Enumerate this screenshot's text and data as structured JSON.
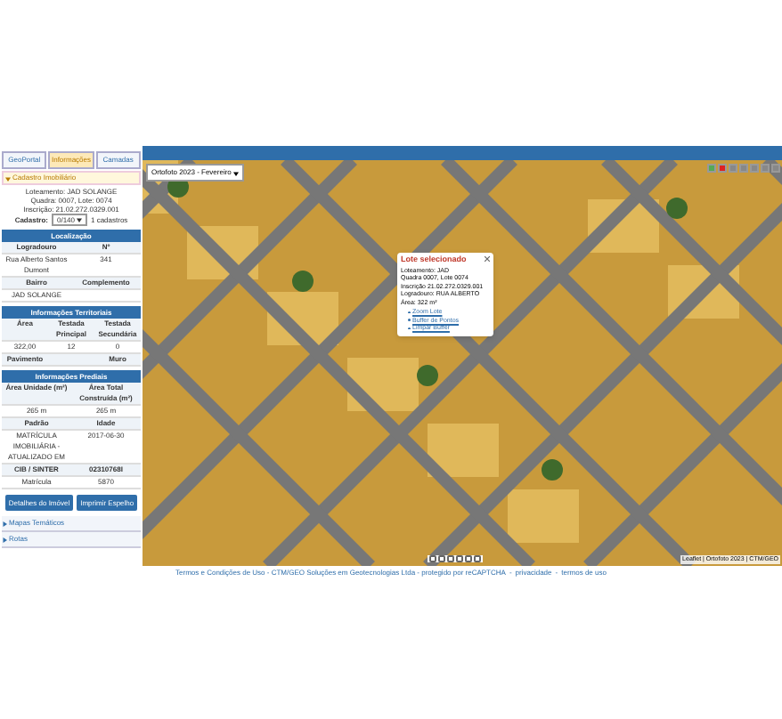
{
  "tabs": [
    {
      "label": "GeoPortal",
      "selected": false
    },
    {
      "label": "Informações",
      "selected": true
    },
    {
      "label": "Camadas",
      "selected": false
    }
  ],
  "section": {
    "title": "Cadastro Imobiliário",
    "expanded": true
  },
  "summary": [
    "Loteamento: JAD SOLANGE",
    "Quadra: 0007, Lote: 0074",
    "Inscrição: 21.02.272.0329.001"
  ],
  "cadastro": {
    "label": "Cadastro:",
    "value": "0/140",
    "count": "1 cadastros"
  },
  "tables": [
    {
      "title": "Localização",
      "rows": [
        [
          "Logradouro",
          "Nº"
        ],
        [
          "Rua Alberto Santos Dumont",
          "341"
        ],
        [
          "Bairro",
          "Complemento"
        ],
        [
          "JAD SOLANGE",
          ""
        ]
      ]
    },
    {
      "title": "Informações Territoriais",
      "rows": [
        [
          "Área",
          "Testada Principal",
          "Testada Secundária"
        ],
        [
          "322,00",
          "12",
          "0"
        ],
        [
          "Pavimento",
          "",
          "Muro"
        ]
      ]
    },
    {
      "title": "Informações Prediais",
      "rows": [
        [
          "Área Unidade (m²)",
          "Área Total Construída (m²)"
        ],
        [
          "265 m",
          "265 m"
        ],
        [
          "Padrão",
          "Idade"
        ],
        [
          "MATRÍCULA IMOBILIÁRIA - ATUALIZADO EM",
          "2017-06-30"
        ],
        [
          "CIB / SINTER",
          "02310768I"
        ],
        [
          "Matrícula",
          "5870"
        ]
      ]
    }
  ],
  "buttons": [
    "Detalhes do Imóvel",
    "Imprimir Espelho"
  ],
  "panels": [
    {
      "label": "Mapas Temáticos",
      "expanded": false
    },
    {
      "label": "Rotas",
      "expanded": false
    }
  ],
  "map": {
    "layer": "Ortofoto 2023 - Fevereiro",
    "popup": {
      "title": "Lote selecionado",
      "lines": [
        "Loteamento: JAD",
        "Quadra 0007, Lote 0074",
        "Inscrição 21.02.272.0329.001",
        "Logradouro: RUA ALBERTO",
        "Área: 322 m²"
      ],
      "links": [
        "Zoom Lote",
        "Buffer de Pontos",
        "Limpar Buffer"
      ]
    },
    "attribution": "Leaflet | Ortofoto 2023 | CTM/GEO"
  },
  "footer": {
    "text": "Termos e Condições de Uso - CTM/GEO Soluções em Geotecnologias Ltda - protegido por reCAPTCHA",
    "separator": "-",
    "links": [
      "privacidade",
      "termos de uso"
    ]
  }
}
